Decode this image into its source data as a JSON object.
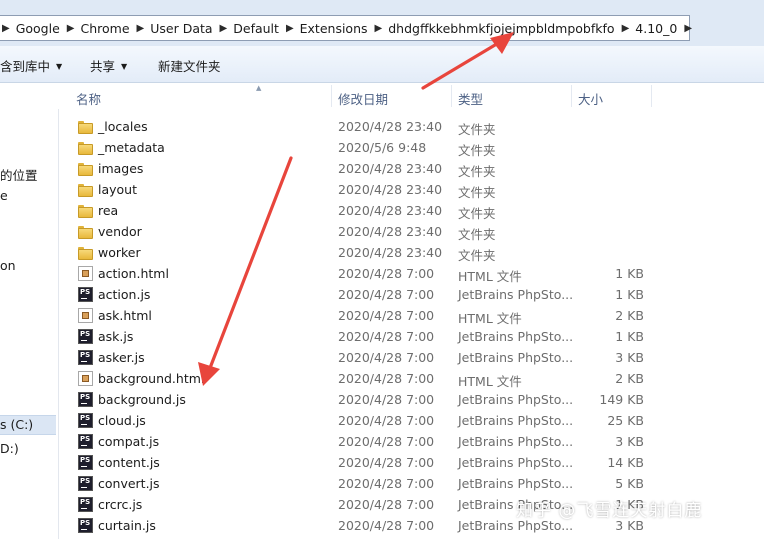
{
  "address_bar": {
    "crumbs": [
      "Google",
      "Chrome",
      "User Data",
      "Default",
      "Extensions",
      "dhdgffkkebhmkfjojejmpbldmpobfkfo",
      "4.10_0"
    ]
  },
  "toolbar": {
    "add_to_library": "含到库中",
    "share": "共享",
    "new_folder": "新建文件夹"
  },
  "nav_pane": {
    "items": [
      "的位置",
      "e",
      "on",
      "s (C:)",
      "D:)"
    ]
  },
  "columns": {
    "name": "名称",
    "date": "修改日期",
    "type": "类型",
    "size": "大小"
  },
  "files": [
    {
      "icon": "folder-icon",
      "name": "_locales",
      "date": "2020/4/28 23:40",
      "type": "文件夹",
      "size": ""
    },
    {
      "icon": "folder-icon",
      "name": "_metadata",
      "date": "2020/5/6 9:48",
      "type": "文件夹",
      "size": ""
    },
    {
      "icon": "folder-icon",
      "name": "images",
      "date": "2020/4/28 23:40",
      "type": "文件夹",
      "size": ""
    },
    {
      "icon": "folder-icon",
      "name": "layout",
      "date": "2020/4/28 23:40",
      "type": "文件夹",
      "size": ""
    },
    {
      "icon": "folder-icon",
      "name": "rea",
      "date": "2020/4/28 23:40",
      "type": "文件夹",
      "size": ""
    },
    {
      "icon": "folder-icon",
      "name": "vendor",
      "date": "2020/4/28 23:40",
      "type": "文件夹",
      "size": ""
    },
    {
      "icon": "folder-icon",
      "name": "worker",
      "date": "2020/4/28 23:40",
      "type": "文件夹",
      "size": ""
    },
    {
      "icon": "html-file-icon",
      "name": "action.html",
      "date": "2020/4/28 7:00",
      "type": "HTML 文件",
      "size": "1 KB"
    },
    {
      "icon": "phpstorm-js-icon",
      "name": "action.js",
      "date": "2020/4/28 7:00",
      "type": "JetBrains PhpSto...",
      "size": "1 KB"
    },
    {
      "icon": "html-file-icon",
      "name": "ask.html",
      "date": "2020/4/28 7:00",
      "type": "HTML 文件",
      "size": "2 KB"
    },
    {
      "icon": "phpstorm-js-icon",
      "name": "ask.js",
      "date": "2020/4/28 7:00",
      "type": "JetBrains PhpSto...",
      "size": "1 KB"
    },
    {
      "icon": "phpstorm-js-icon",
      "name": "asker.js",
      "date": "2020/4/28 7:00",
      "type": "JetBrains PhpSto...",
      "size": "3 KB"
    },
    {
      "icon": "html-file-icon",
      "name": "background.html",
      "date": "2020/4/28 7:00",
      "type": "HTML 文件",
      "size": "2 KB"
    },
    {
      "icon": "phpstorm-js-icon",
      "name": "background.js",
      "date": "2020/4/28 7:00",
      "type": "JetBrains PhpSto...",
      "size": "149 KB"
    },
    {
      "icon": "phpstorm-js-icon",
      "name": "cloud.js",
      "date": "2020/4/28 7:00",
      "type": "JetBrains PhpSto...",
      "size": "25 KB"
    },
    {
      "icon": "phpstorm-js-icon",
      "name": "compat.js",
      "date": "2020/4/28 7:00",
      "type": "JetBrains PhpSto...",
      "size": "3 KB"
    },
    {
      "icon": "phpstorm-js-icon",
      "name": "content.js",
      "date": "2020/4/28 7:00",
      "type": "JetBrains PhpSto...",
      "size": "14 KB"
    },
    {
      "icon": "phpstorm-js-icon",
      "name": "convert.js",
      "date": "2020/4/28 7:00",
      "type": "JetBrains PhpSto...",
      "size": "5 KB"
    },
    {
      "icon": "phpstorm-js-icon",
      "name": "crcrc.js",
      "date": "2020/4/28 7:00",
      "type": "JetBrains PhpSto...",
      "size": "1 KB"
    },
    {
      "icon": "phpstorm-js-icon",
      "name": "curtain.js",
      "date": "2020/4/28 7:00",
      "type": "JetBrains PhpSto...",
      "size": "3 KB"
    }
  ],
  "watermark": "知乎 @飞雪连天射白鹿",
  "annotation_color": "#e8453c"
}
